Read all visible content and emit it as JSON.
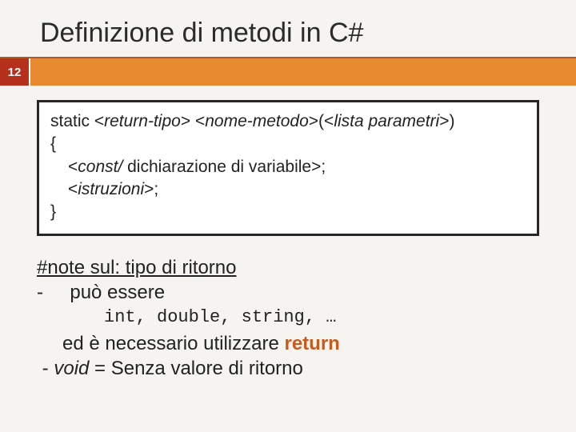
{
  "title": "Definizione di metodi in C#",
  "page_number": "12",
  "code": {
    "sig_prefix": "static <",
    "return_type": "return-tipo",
    "sig_mid": "> <",
    "method_name": "nome-metodo",
    "sig_paren_open": ">(<",
    "param_list": "lista parametri",
    "sig_close": ">)",
    "brace_open": "{",
    "decl_open": "<",
    "decl_const": "const/",
    "decl_text": " dichiarazione di variabile>;",
    "instr_open": "<",
    "instr_text": "istruzioni",
    "instr_close": ">;",
    "brace_close": "}"
  },
  "notes": {
    "heading": "#note sul: tipo di ritorno",
    "bullet1_dash": "-",
    "bullet1_text": "può essere",
    "types_line": "int, double, string, …",
    "line3a": "ed è necessario utilizzare ",
    "return_kw": "return",
    "bullet2_dash": "- ",
    "void_kw": "void",
    "bullet2_text": " = Senza valore di ritorno"
  }
}
